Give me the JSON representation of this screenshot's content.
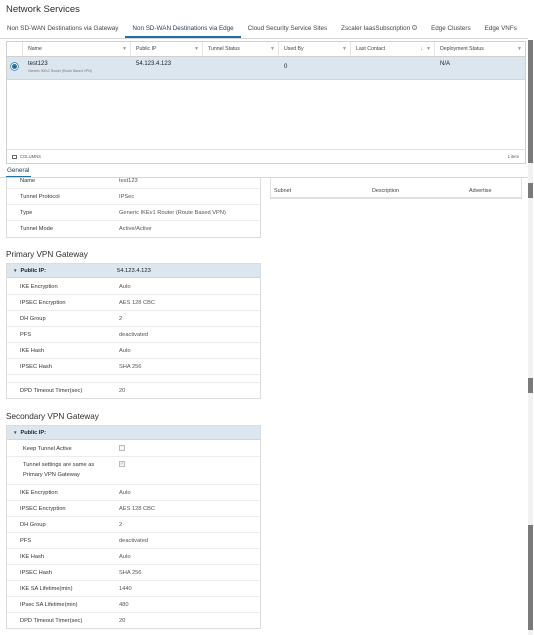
{
  "page": {
    "title": "Network Services"
  },
  "tabs": [
    {
      "label": "Non SD-WAN Destinations via Gateway",
      "active": false
    },
    {
      "label": "Non SD-WAN Destinations via Edge",
      "active": true
    },
    {
      "label": "Cloud Security Service Sites",
      "active": false
    },
    {
      "label": "Zscaler IaasSubscription",
      "active": false
    },
    {
      "label": "Edge Clusters",
      "active": false
    },
    {
      "label": "Edge VNFs",
      "active": false
    }
  ],
  "grid": {
    "columns": [
      "Name",
      "Public IP",
      "Tunnel Status",
      "Used By",
      "Last Contact",
      "Deployment Status"
    ],
    "rows": [
      {
        "name": "test123",
        "subtitle": "Generic IKEv1 Router (Route Based VPN)",
        "public_ip": "54.123.4.123",
        "tunnel_status": "",
        "used_by": "0",
        "last_contact": "",
        "deployment_status": "N/A",
        "selected": true
      }
    ],
    "footer": {
      "columns_label": "COLUMNS",
      "item_count": "1 item"
    }
  },
  "detail_tabs": {
    "general": "General"
  },
  "tunnel_info": [
    {
      "key": "Name",
      "value": "test123"
    },
    {
      "key": "Tunnel Protocol",
      "value": "IPSec"
    },
    {
      "key": "Type",
      "value": "Generic IKEv1 Router (Route Based VPN)"
    },
    {
      "key": "Tunnel Mode",
      "value": "Active/Active"
    }
  ],
  "subnet_table": {
    "columns": [
      "Subnet",
      "Description",
      "Advertise"
    ]
  },
  "primary": {
    "title": "Primary VPN Gateway",
    "header_key": "Public IP:",
    "header_value": "54.123.4.123",
    "rows": [
      {
        "key": "IKE Encryption",
        "value": "Auto"
      },
      {
        "key": "IPSEC Encryption",
        "value": "AES 128 CBC"
      },
      {
        "key": "DH Group",
        "value": "2"
      },
      {
        "key": "PFS",
        "value": "deactivated"
      },
      {
        "key": "IKE Hash",
        "value": "Auto"
      },
      {
        "key": "IPSEC Hash",
        "value": "SHA 256"
      },
      {
        "key": "",
        "value": ""
      },
      {
        "key": "DPD Timeout Timer(sec)",
        "value": "20"
      }
    ]
  },
  "secondary": {
    "title": "Secondary VPN Gateway",
    "header_key": "Public IP:",
    "header_value": "",
    "keep_tunnel_active": "Keep Tunnel Active",
    "same_as_primary_1": "Tunnel settings are same as",
    "same_as_primary_2": "Primary VPN Gateway",
    "check_mark": "✓",
    "rows": [
      {
        "key": "IKE Encryption",
        "value": "Auto"
      },
      {
        "key": "IPSEC Encryption",
        "value": "AES 128 CBC"
      },
      {
        "key": "DH Group",
        "value": "2"
      },
      {
        "key": "PFS",
        "value": "deactivated"
      },
      {
        "key": "IKE Hash",
        "value": "Auto"
      },
      {
        "key": "IPSEC Hash",
        "value": "SHA 256"
      },
      {
        "key": "IKE SA Lifetime(min)",
        "value": "1440"
      },
      {
        "key": "IPsec SA Lifetime(min)",
        "value": "480"
      },
      {
        "key": "DPD Timeout Timer(sec)",
        "value": "20"
      }
    ]
  },
  "icons": {
    "filter": "filter-icon",
    "sort": "sort-arrow-icon",
    "info": "info-icon",
    "caret": "caret-down-icon",
    "columns": "columns-icon"
  },
  "colors": {
    "accent": "#1f6fa8",
    "selected_row": "#dbe6ef"
  }
}
